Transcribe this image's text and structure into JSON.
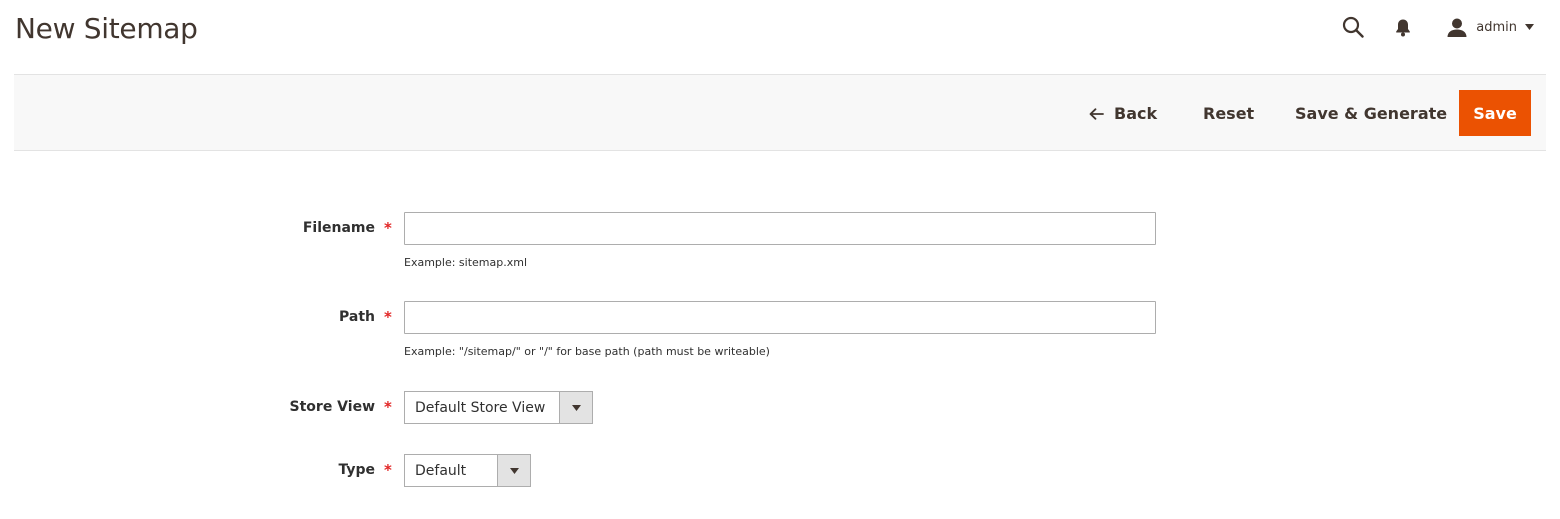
{
  "header": {
    "title": "New Sitemap",
    "user_name": "admin",
    "icons": {
      "search": "search-icon",
      "notifications": "bell-icon",
      "user": "user-icon",
      "dropdown": "caret-down-icon"
    }
  },
  "actions": {
    "back_label": "Back",
    "reset_label": "Reset",
    "save_generate_label": "Save & Generate",
    "save_label": "Save"
  },
  "form": {
    "filename": {
      "label": "Filename",
      "required": "*",
      "value": "",
      "note": "Example: sitemap.xml"
    },
    "path": {
      "label": "Path",
      "required": "*",
      "value": "",
      "note": "Example: \"/sitemap/\" or \"/\" for base path (path must be writeable)"
    },
    "store_view": {
      "label": "Store View",
      "required": "*",
      "selected": "Default Store View"
    },
    "type": {
      "label": "Type",
      "required": "*",
      "selected": "Default"
    }
  },
  "colors": {
    "accent": "#eb5202",
    "required": "#e22626",
    "title": "#41362f",
    "action_bar_bg": "#f8f8f8"
  }
}
